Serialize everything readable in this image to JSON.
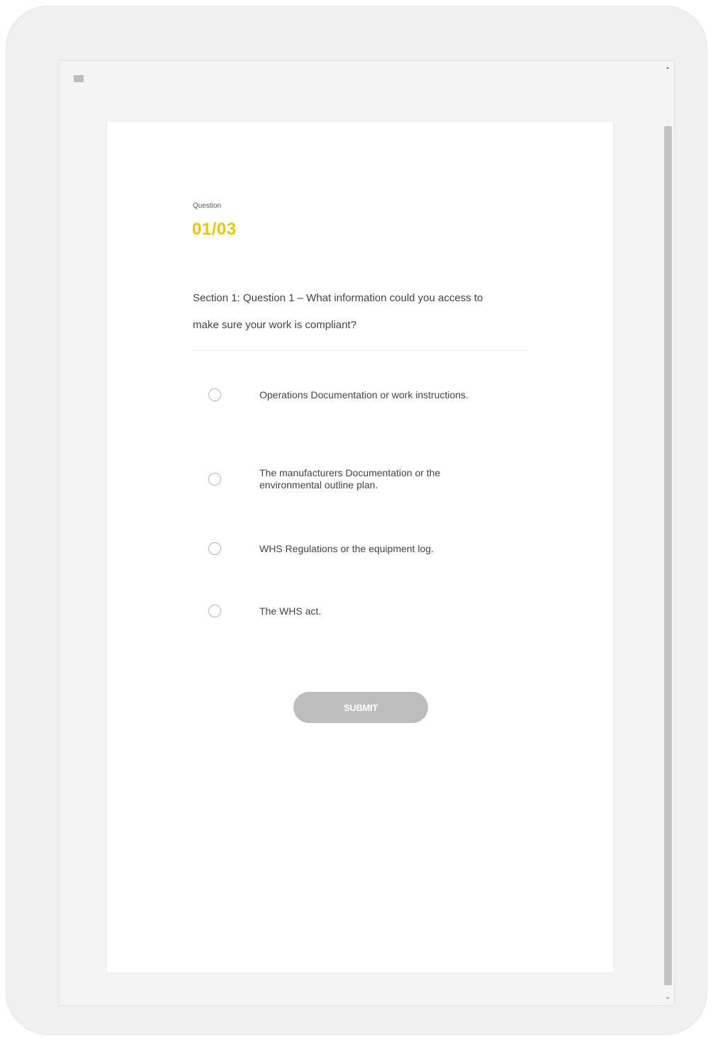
{
  "quiz": {
    "question_label": "Question",
    "counter": "01/03",
    "question_text": "Section 1: Question 1 – What information could you access to make sure your work is compliant?",
    "options": [
      {
        "label": "Operations Documentation or work instructions."
      },
      {
        "label": "The manufacturers Documentation or the environmental outline plan."
      },
      {
        "label": "WHS Regulations or the equipment log."
      },
      {
        "label": "The WHS act."
      }
    ],
    "submit_label": "SUBMIT"
  },
  "colors": {
    "accent": "#f2c400",
    "button_disabled": "#bdbdbd"
  },
  "icons": {
    "menu": "menu-icon"
  }
}
